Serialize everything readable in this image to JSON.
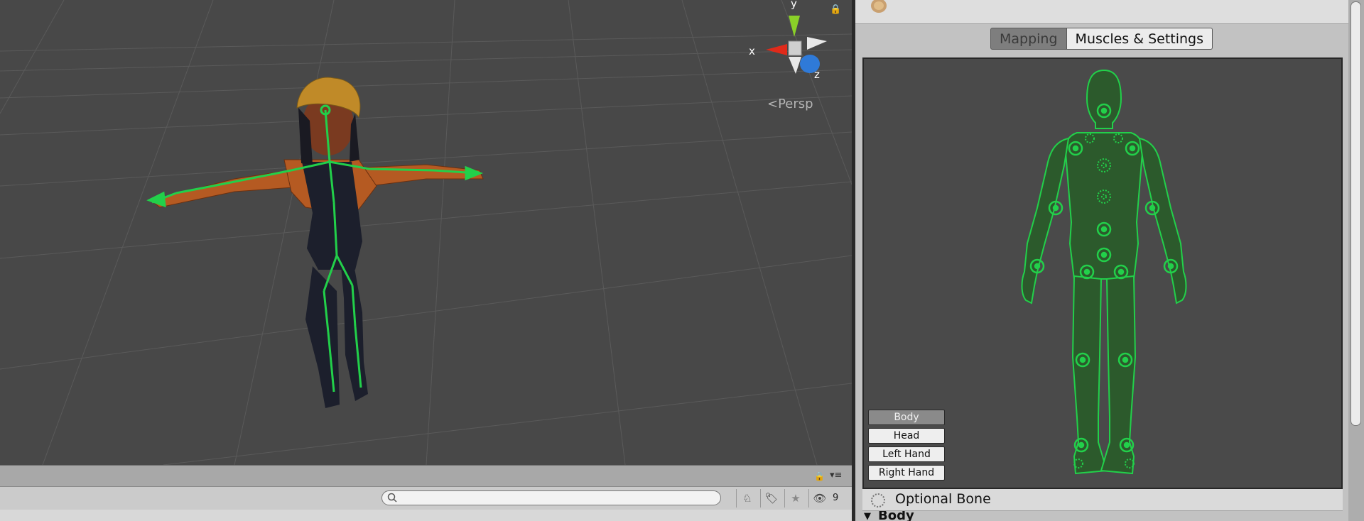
{
  "scene": {
    "projection_label": "Persp",
    "gizmo": {
      "axis_x": "x",
      "axis_y": "y",
      "axis_z": "z"
    },
    "lock_icon": "lock-icon"
  },
  "toolbar": {
    "search_placeholder": "",
    "hidden_count": "9",
    "icons": [
      "layers-icon",
      "tag-icon",
      "star-icon",
      "eye-hidden-icon"
    ]
  },
  "inspector": {
    "tabs": [
      {
        "label": "Mapping",
        "active": true
      },
      {
        "label": "Muscles & Settings",
        "active": false
      }
    ],
    "body_parts": [
      "Body",
      "Head",
      "Left Hand",
      "Right Hand"
    ],
    "selected_part": "Body",
    "legend": {
      "optional_bone": "Optional Bone"
    },
    "section": {
      "body": "Body"
    }
  },
  "colors": {
    "scene_bg": "#484848",
    "bone_green": "#22d04a",
    "inspector_bg": "#c2c2c2",
    "avatar_fill": "#2c5a2c"
  }
}
